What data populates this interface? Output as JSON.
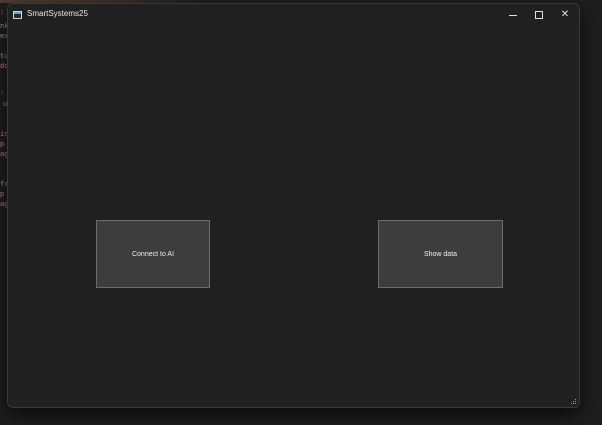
{
  "window": {
    "title": "SmartSystems25",
    "controls": {
      "minimize_icon": "minimize-icon",
      "maximize_icon": "maximize-icon",
      "close_icon": "close-icon",
      "close_glyph": "✕"
    }
  },
  "main": {
    "connect_label": "Connect to AI",
    "show_data_label": "Show data"
  },
  "background_editor": {
    "fragments": [
      ":",
      "nk",
      "ex",
      "tu",
      "do",
      ":",
      "u",
      "in",
      "p",
      "ag",
      "fr",
      "p",
      "ag"
    ]
  },
  "colors": {
    "window_bg": "#202020",
    "button_bg": "#3d3d3d",
    "button_border": "#6c6c6c",
    "text": "#f0f0f0"
  }
}
